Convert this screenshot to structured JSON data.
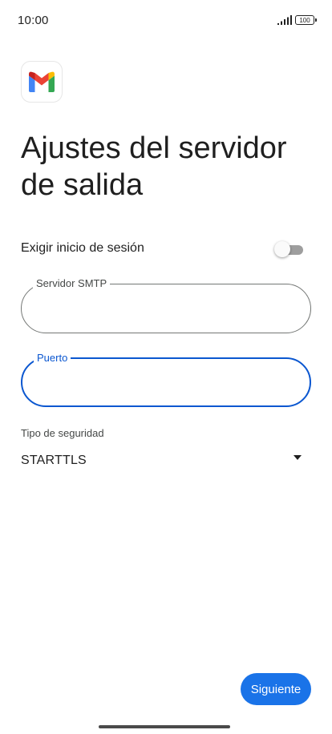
{
  "status_bar": {
    "time": "10:00",
    "battery_level": "100",
    "signal_icon": "signal-bars-icon"
  },
  "app": {
    "logo_icon": "gmail-logo",
    "brand_colors": {
      "blue": "#4285F4",
      "red": "#EA4335",
      "yellow": "#FBBC04",
      "green": "#34A853"
    }
  },
  "page": {
    "title": "Ajustes del servidor de salida"
  },
  "login_toggle": {
    "label": "Exigir inicio de sesión",
    "enabled": false
  },
  "smtp_field": {
    "label": "Servidor SMTP",
    "value": ""
  },
  "port_field": {
    "label": "Puerto",
    "value": "",
    "focused": true,
    "focus_color": "#0B57D0"
  },
  "security": {
    "label": "Tipo de seguridad",
    "selected": "STARTTLS",
    "icon": "dropdown-arrow-icon"
  },
  "actions": {
    "next_label": "Siguiente",
    "accent_color": "#1A73E8"
  }
}
